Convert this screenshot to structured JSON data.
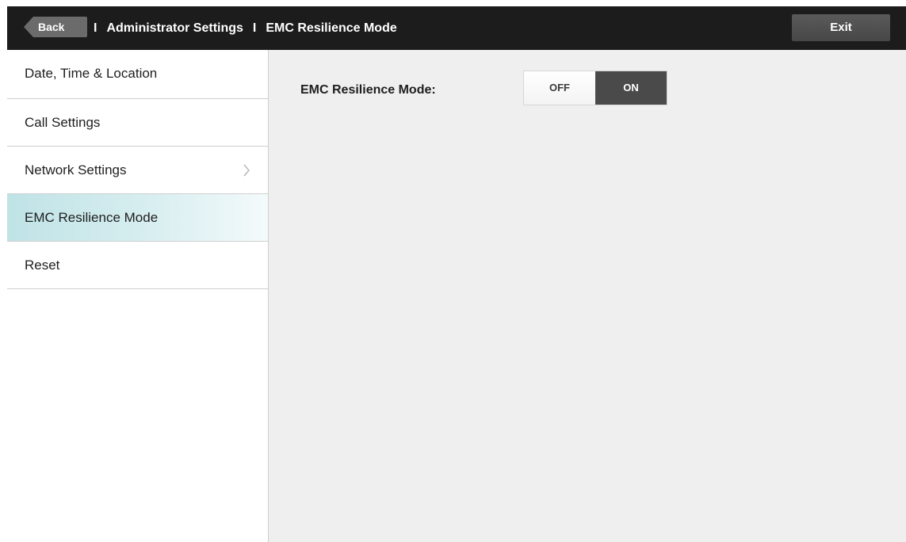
{
  "header": {
    "back_label": "Back",
    "separator": "I",
    "breadcrumb": [
      "Administrator Settings",
      "EMC Resilience Mode"
    ],
    "exit_label": "Exit"
  },
  "sidebar": {
    "items": [
      {
        "label": "Date, Time & Location",
        "active": false,
        "has_chevron": false
      },
      {
        "label": "Call Settings",
        "active": false,
        "has_chevron": false
      },
      {
        "label": "Network Settings",
        "active": false,
        "has_chevron": true
      },
      {
        "label": "EMC Resilience Mode",
        "active": true,
        "has_chevron": false
      },
      {
        "label": "Reset",
        "active": false,
        "has_chevron": false
      }
    ],
    "chevron_icon": "chevron-right-icon"
  },
  "main": {
    "setting_label": "EMC Resilience Mode:",
    "toggle": {
      "off_label": "OFF",
      "on_label": "ON",
      "selected": "ON"
    }
  },
  "colors": {
    "header_bg": "#1c1c1c",
    "active_item": "#bfe3e6",
    "toggle_on_bg": "#4a4a4a",
    "back_button_bg": "#6b6b6b"
  }
}
